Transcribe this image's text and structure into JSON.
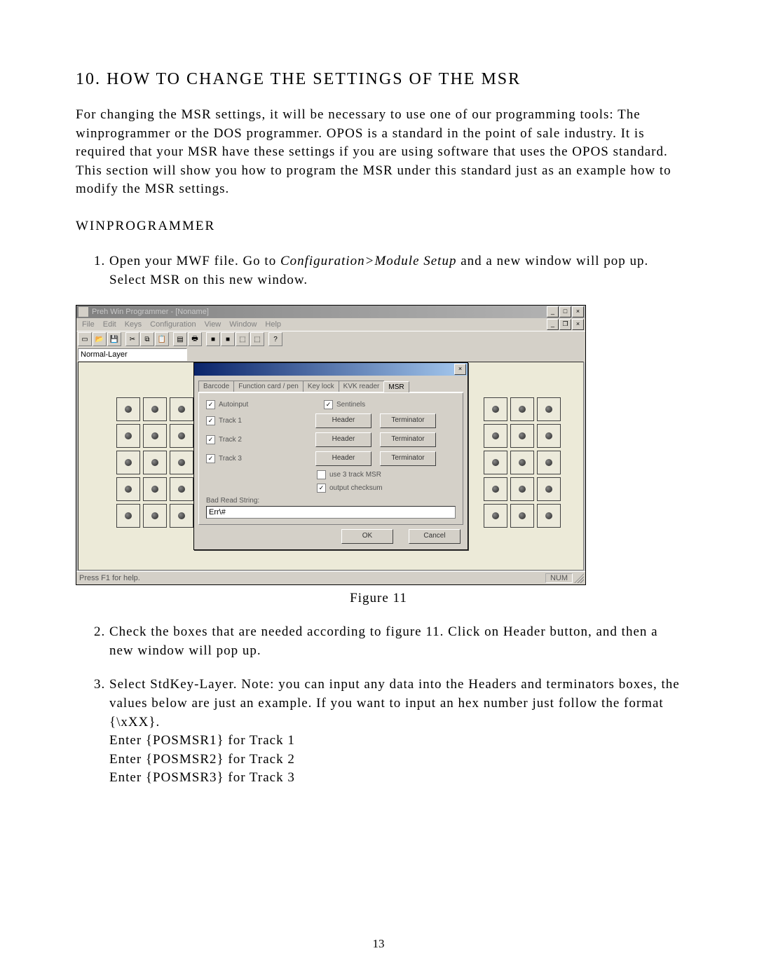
{
  "section_number": "10.",
  "heading": "10. HOW TO CHANGE THE SETTINGS OF THE MSR",
  "intro": "For changing the MSR settings, it will be necessary to use one of our programming tools: The winprogrammer or the DOS programmer. OPOS is a standard in the point of sale industry. It is required that your MSR have these settings if you are using software that uses the OPOS standard. This section will show you how to program the MSR under this standard just as an example how to modify the MSR settings.",
  "subheading": "WINPROGRAMMER",
  "steps": {
    "s1_a": "Open your MWF file. Go to ",
    "s1_em": "Configuration>Module Setup",
    "s1_b": " and a new window will pop up. Select MSR on this new window.",
    "s2": "Check the boxes that are needed according to figure 11. Click on Header button, and then a new window will pop up.",
    "s3": "Select StdKey-Layer. Note: you can input any data into the Headers and terminators boxes, the values below are just an example. If you want to input an hex number just follow the format {\\xXX}.",
    "s3_l1": "Enter {POSMSR1} for Track 1",
    "s3_l2": "Enter {POSMSR2} for Track 2",
    "s3_l3": "Enter {POSMSR3} for Track 3"
  },
  "figure_caption": "Figure 11",
  "page_number": "13",
  "app": {
    "title": "Preh Win Programmer - [Noname]",
    "menus": [
      "File",
      "Edit",
      "Keys",
      "Configuration",
      "View",
      "Window",
      "Help"
    ],
    "layer_value": "Normal-Layer",
    "status_left": "Press F1 for help.",
    "status_num": "NUM"
  },
  "dialog": {
    "tabs": [
      "Barcode",
      "Function card / pen",
      "Key lock",
      "KVK reader",
      "MSR"
    ],
    "active_tab_index": 4,
    "autoinput": "Autoinput",
    "sentinels": "Sentinels",
    "track1": "Track 1",
    "track2": "Track 2",
    "track3": "Track 3",
    "header_btn": "Header",
    "terminator_btn": "Terminator",
    "use3track": "use 3 track MSR",
    "output_checksum": "output checksum",
    "bad_read_label": "Bad Read String:",
    "bad_read_value": "Err\\#",
    "ok": "OK",
    "cancel": "Cancel"
  }
}
